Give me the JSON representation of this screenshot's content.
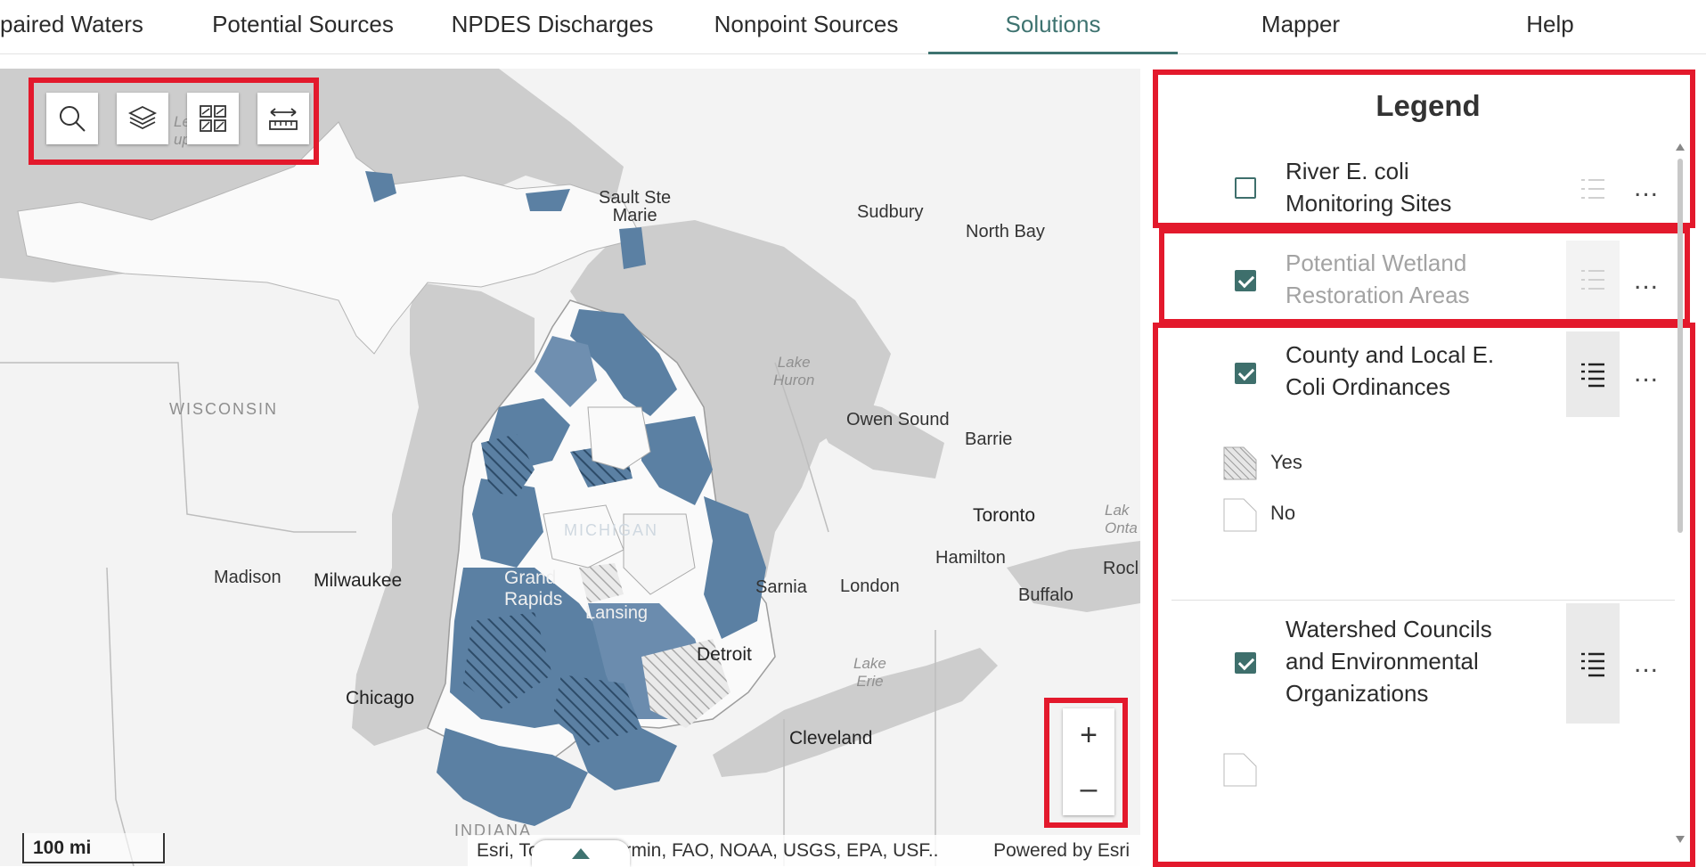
{
  "nav": {
    "tabs": [
      {
        "label": "paired Waters",
        "active": false
      },
      {
        "label": "Potential Sources",
        "active": false
      },
      {
        "label": "NPDES Discharges",
        "active": false
      },
      {
        "label": "Nonpoint Sources",
        "active": false
      },
      {
        "label": "Solutions",
        "active": true
      },
      {
        "label": "Mapper",
        "active": false
      },
      {
        "label": "Help",
        "active": false
      }
    ]
  },
  "map": {
    "toolbar": [
      "search-icon",
      "layers-icon",
      "basemap-gallery-icon",
      "measure-icon"
    ],
    "labels": {
      "sault_ste_marie": "Sault Ste\nMarie",
      "sudbury": "Sudbury",
      "north_bay": "North Bay",
      "wisconsin": "WISCONSIN",
      "lake_huron": "Lake\nHuron",
      "owen_sound": "Owen Sound",
      "barrie": "Barrie",
      "toronto": "Toronto",
      "lake_ontario": "Lak\nOnta",
      "hamilton": "Hamilton",
      "rochester": "Rocl",
      "michigan": "MICHIGAN",
      "madison": "Madison",
      "milwaukee": "Milwaukee",
      "grand_rapids": "Grand\nRapids",
      "lansing": "Lansing",
      "sarnia": "Sarnia",
      "london": "London",
      "buffalo": "Buffalo",
      "detroit": "Detroit",
      "lake_erie": "Lake\nErie",
      "chicago": "Chicago",
      "cleveland": "Cleveland",
      "indiana": "INDIANA",
      "lake_superior": "Le\nup"
    },
    "scalebar": "100 mi",
    "attribution": "Esri, TomTom, Garmin, FAO, NOAA, USGS, EPA, USF...",
    "powered_by": "Powered by Esri",
    "zoom_in": "+",
    "zoom_out": "–"
  },
  "legend": {
    "title": "Legend",
    "layers": [
      {
        "name": "River E. coli Monitoring Sites",
        "line1": "River E. coli",
        "line2": "Monitoring Sites",
        "visible": false
      },
      {
        "name": "Potential Wetland Restoration Areas",
        "line1": "Potential Wetland",
        "line2": "Restoration Areas",
        "visible": true
      },
      {
        "name": "County and Local E. Coli Ordinances",
        "line1": "County and Local E.",
        "line2": "Coli Ordinances",
        "visible": true,
        "symbols": [
          {
            "label": "Yes",
            "fill": "hatched"
          },
          {
            "label": "No",
            "fill": "none"
          }
        ]
      },
      {
        "name": "Watershed Councils and Environmental Organizations",
        "line1": "Watershed Councils",
        "line2": "and Environmental",
        "line3": "Organizations",
        "visible": true
      }
    ],
    "more_label": "..."
  },
  "colors": {
    "accent": "#3e7370",
    "watershed_fill": "#5b80a3",
    "highlight_box": "#e3192c",
    "land": "#f4f4f4",
    "water": "#cfcfcf"
  }
}
